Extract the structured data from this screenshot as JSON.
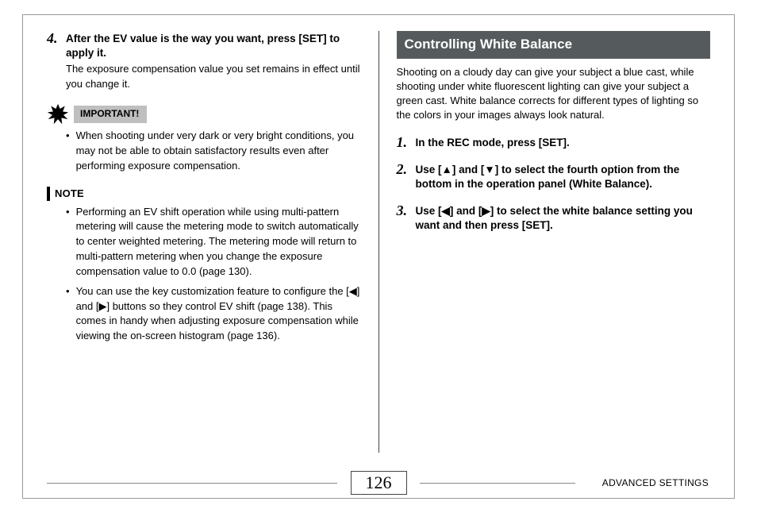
{
  "left": {
    "step4_num": "4.",
    "step4_text": "After the EV value is the way you want, press [SET] to apply it.",
    "step4_sub": "The exposure compensation value you set remains in effect until you change it.",
    "important_label": "IMPORTANT!",
    "important_bullets": [
      "When shooting under very dark or very bright conditions, you may not be able to obtain satisfactory results even after performing exposure compensation."
    ],
    "note_label": "NOTE",
    "note_bullets": [
      "Performing an EV shift operation while using multi-pattern metering will cause the metering mode to switch automatically to center weighted metering. The metering mode will return to multi-pattern metering when you change the exposure compensation value to 0.0 (page 130).",
      "You can use the key customization feature to configure the [◀] and [▶] buttons so they control EV shift (page 138). This comes in handy when adjusting exposure compensation while viewing the on-screen histogram (page 136)."
    ]
  },
  "right": {
    "title": "Controlling White Balance",
    "intro": "Shooting on a cloudy day can give your subject a blue cast, while shooting under white fluorescent lighting can give your subject a green cast. White balance corrects for different types of lighting so the colors in your images always look natural.",
    "steps": [
      {
        "num": "1.",
        "text": "In the REC mode, press [SET]."
      },
      {
        "num": "2.",
        "text": "Use [▲] and [▼] to select the fourth option from the bottom in the operation panel (White Balance)."
      },
      {
        "num": "3.",
        "text": "Use [◀] and [▶] to select the white balance setting you want and then press [SET]."
      }
    ]
  },
  "footer": {
    "page_number": "126",
    "section": "ADVANCED SETTINGS"
  }
}
